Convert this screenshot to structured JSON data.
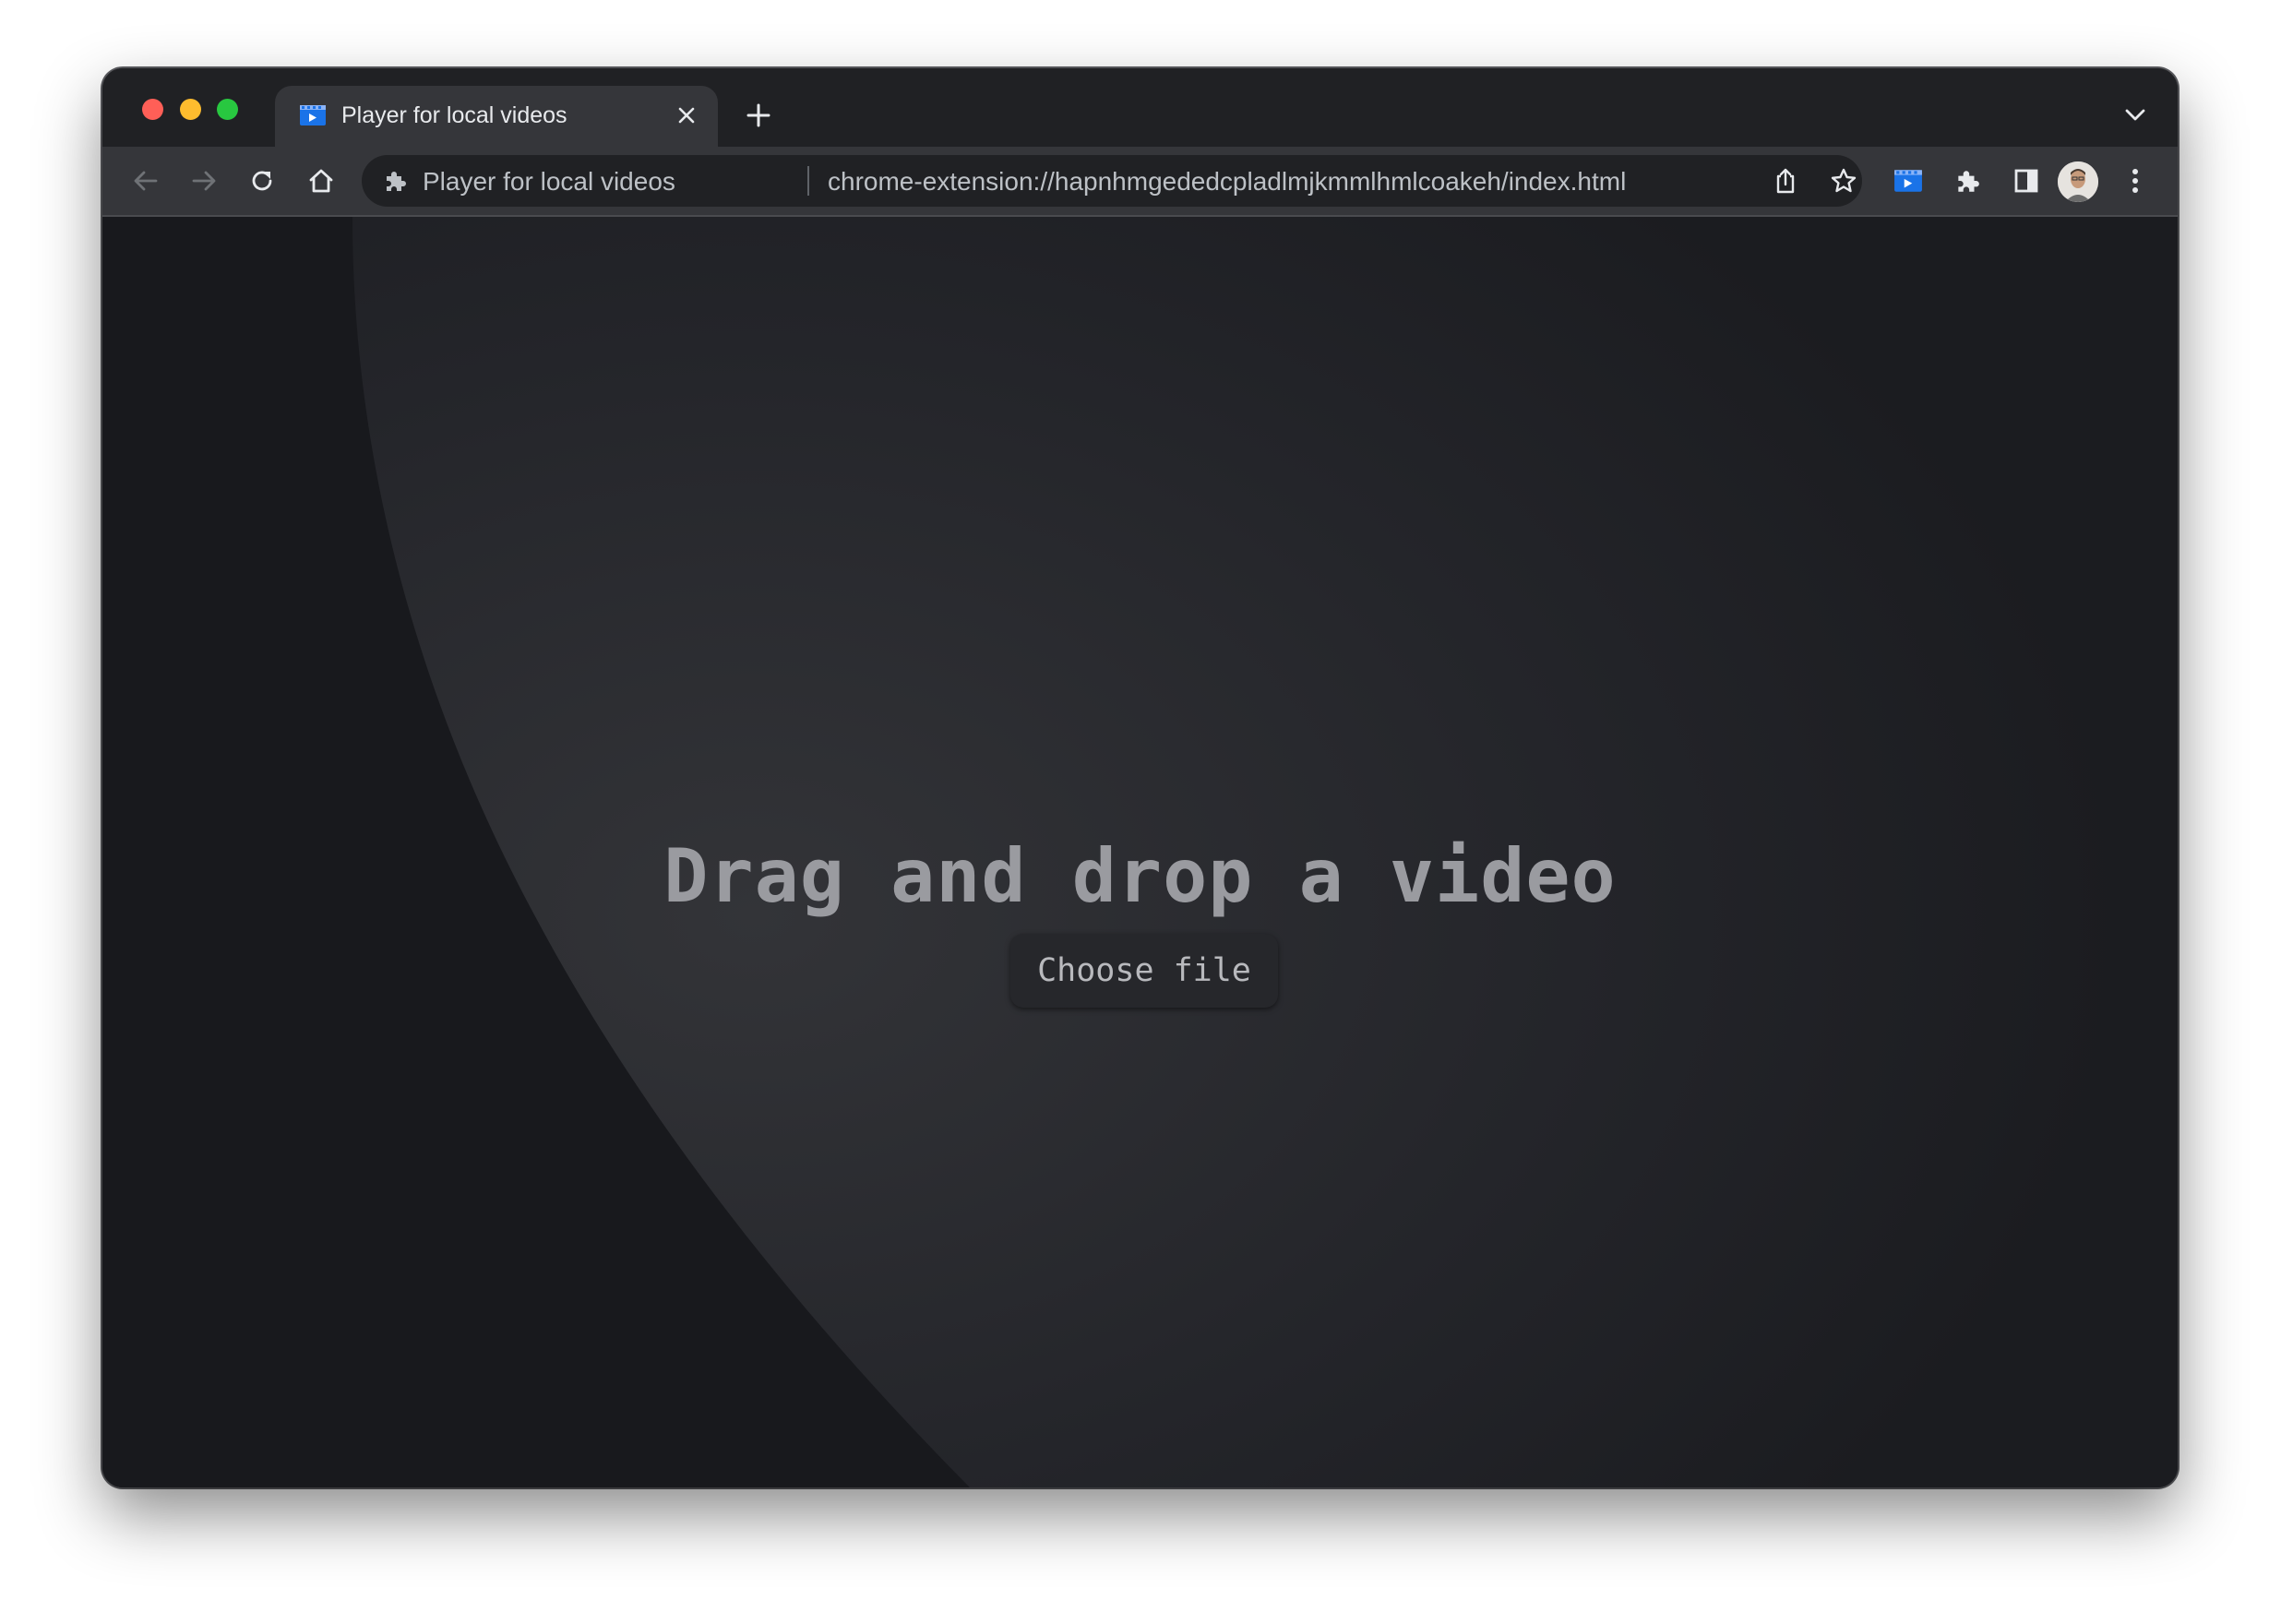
{
  "browser": {
    "tab": {
      "title": "Player for local videos",
      "favicon": "video-player-icon"
    },
    "omnibox": {
      "site_label": "Player for local videos",
      "url": "chrome-extension://hapnhmgededcpladlmjkmmlhmlcoakeh/index.html"
    },
    "icons": {
      "back": "arrow-left-icon",
      "forward": "arrow-right-icon",
      "reload": "reload-icon",
      "home": "home-icon",
      "share": "share-icon",
      "bookmark": "star-icon",
      "extension_pinned": "video-player-icon",
      "extensions": "puzzle-icon",
      "side_panel": "side-panel-icon",
      "menu": "kebab-menu-icon"
    }
  },
  "page": {
    "heading": "Drag and drop a video",
    "choose_file_label": "Choose file"
  },
  "colors": {
    "traffic_close": "#ff5f57",
    "traffic_minimize": "#febc2e",
    "traffic_maximize": "#28c840",
    "page_background": "#18191d",
    "curve_highlight": "#2f3034"
  }
}
